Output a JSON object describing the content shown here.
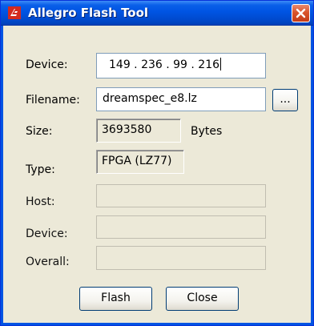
{
  "window": {
    "title": "Allegro Flash Tool"
  },
  "form": {
    "device_label": "Device:",
    "device_ip": "149 . 236 . 99 . 216",
    "filename_label": "Filename:",
    "filename_value": "dreamspec_e8.lz",
    "browse_label": "...",
    "size_label": "Size:",
    "size_value": "3693580",
    "size_unit": "Bytes",
    "type_label": "Type:",
    "type_value": "FPGA (LZ77)",
    "progress_host_label": "Host:",
    "progress_device_label": "Device:",
    "progress_overall_label": "Overall:"
  },
  "buttons": {
    "flash": "Flash",
    "close": "Close"
  },
  "colors": {
    "title_bar": "#0054e3",
    "close_button": "#d9542c",
    "window_bg": "#ece9d8"
  }
}
